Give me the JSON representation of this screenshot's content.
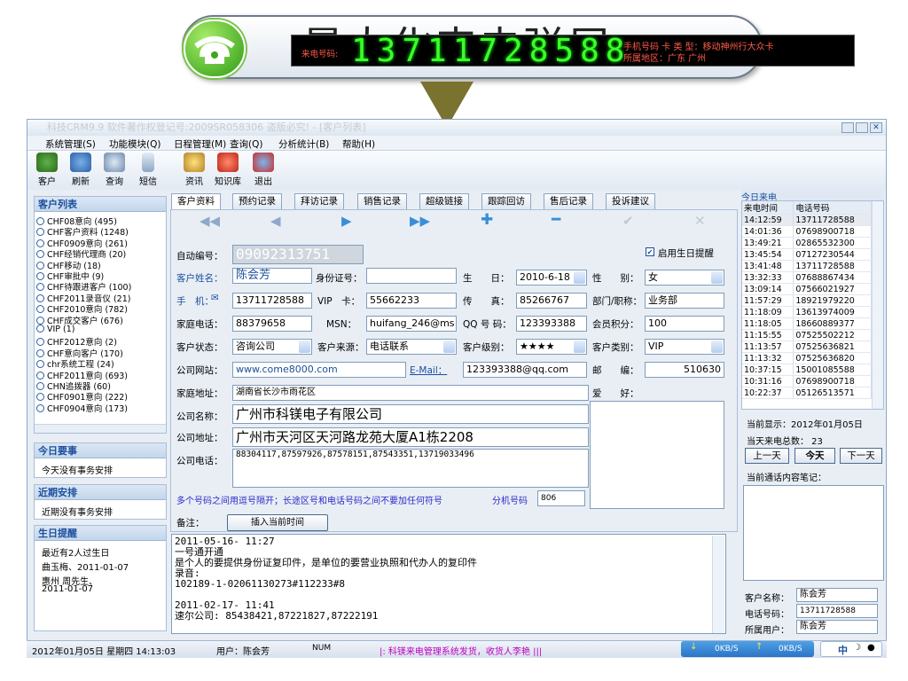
{
  "slide": {
    "title": "最大化来电弹屏"
  },
  "app": {
    "title": "科技CRM9.9 软件著作权登记号:2009SR058306 盗版必究! - [客户列表]",
    "menu": [
      "系统管理(S)",
      "功能模块(Q)",
      "日程管理(M)",
      "查询(Q)",
      "分析统计(B)",
      "帮助(H)"
    ],
    "toolbar": [
      "客户",
      "刷新",
      "查询",
      "短信",
      "资讯",
      "知识库",
      "退出"
    ],
    "led": {
      "caption": "来电号码:",
      "number": "13711728588",
      "line1": "手机号码      卡 类 型：移动神州行大众卡",
      "line2": "所属地区：广东 广州"
    }
  },
  "left": {
    "customer_list_header": "客户列表",
    "customer_items": [
      "CHF08意向 (495)",
      "CHF客户资料 (1248)",
      "CHF0909意向 (261)",
      "CHF经销代理商 (20)",
      "CHF移动 (18)",
      "CHF审批中 (9)",
      "CHF待跟进客户 (100)",
      "CHF2011录音仪 (21)",
      "CHF2010意向 (782)",
      "CHF成交客户 (676)",
      "VIP (1)",
      "CHF2012意向 (2)",
      "CHF意向客户 (170)",
      "chr系统工程 (24)",
      "CHF2011意向 (693)",
      "CHN追拨器 (60)",
      "CHF0901意向 (222)",
      "CHF0904意向 (173)"
    ],
    "today_header": "今日要事",
    "today_text": "今天没有事务安排",
    "recent_header": "近期安排",
    "recent_text": "近期没有事务安排",
    "birthday_header": "生日提醒",
    "birthday_lines": [
      "最近有2人过生日",
      "曲玉梅、2011-01-07",
      "惠州 周先生、",
      "2011-01-07"
    ]
  },
  "tabs": [
    "客户资料",
    "预约记录",
    "拜访记录",
    "销售记录",
    "超级链接",
    "跟踪回访",
    "售后记录",
    "投诉建议"
  ],
  "form": {
    "auto_no_label": "自动编号：",
    "auto_no": "09092313751",
    "birthday_check_label": "启用生日提醒",
    "name_label": "客户姓名：",
    "name": "陈会芳",
    "id_label": "身份证号：",
    "id": "",
    "birth_label": "生　　日：",
    "birth": "2010-6-18",
    "gender_label": "性　　别：",
    "gender": "女",
    "mobile_label": "手　机：",
    "mobile": "13711728588",
    "vip_label": "VIP　卡：",
    "vip": "55662233",
    "fax_label": "传　　真：",
    "fax": "85266767",
    "dept_label": "部门/职称：",
    "dept": "业务部",
    "home_tel_label": "家庭电话：",
    "home_tel": "88379658",
    "msn_label": "MSN：",
    "msn": "huifang_246@ms",
    "qq_label": "QQ 号 码：",
    "qq": "123393388",
    "points_label": "会员积分：",
    "points": "100",
    "status_label": "客户状态：",
    "status": "咨询公司",
    "source_label": "客户来源：",
    "source": "电话联系",
    "level_label": "客户级别：",
    "level": "★★★★",
    "type_label": "客户类别：",
    "type": "VIP",
    "web_label": "公司网站：",
    "web": "www.come8000.com",
    "email_label": "E-Mail：",
    "email": "123393388@qq.com",
    "zip_label": "邮　　编：",
    "zip": "510630",
    "home_addr_label": "家庭地址：",
    "home_addr": "湖南省长沙市雨花区",
    "hobby_label": "爱　　好：",
    "company_label": "公司名称：",
    "company": "广州市科镁电子有限公司",
    "company_addr_label": "公司地址：",
    "company_addr": "广州市天河区天河路龙苑大厦A1栋2208",
    "company_tel_label": "公司电话：",
    "company_tel": "88304117,87597926,87578151,87543351,13719033496",
    "hint": "多个号码之间用逗号隔开；长途区号和电话号码之间不要加任何符号",
    "ext_label": "分机号码",
    "ext": "806",
    "remark_label": "备注：",
    "insert_time_btn": "插入当前时间",
    "notes": [
      "2011-05-16- 11:27",
      "一号通开通",
      "是个人的要提供身份证复印件，是单位的要营业执照和代办人的复印件",
      "录音:",
      "102189-1-02061130273#112233#8",
      "",
      "2011-02-17- 11:41",
      "速尔公司: 85438421,87221827,87222191"
    ]
  },
  "right": {
    "header": "今日来电",
    "col_time": "来电时间",
    "col_phone": "电话号码",
    "calls": [
      [
        "14:12:59",
        "13711728588"
      ],
      [
        "14:01:36",
        "07698900718"
      ],
      [
        "13:49:21",
        "02865532300"
      ],
      [
        "13:45:54",
        "07127230544"
      ],
      [
        "13:41:48",
        "13711728588"
      ],
      [
        "13:32:33",
        "07688867434"
      ],
      [
        "13:09:14",
        "07566021927"
      ],
      [
        "11:57:29",
        "18921979220"
      ],
      [
        "11:18:09",
        "13613974009"
      ],
      [
        "11:18:05",
        "18660889377"
      ],
      [
        "11:15:55",
        "07525502212"
      ],
      [
        "11:13:57",
        "07525636821"
      ],
      [
        "11:13:32",
        "07525636820"
      ],
      [
        "10:37:15",
        "15001085588"
      ],
      [
        "10:31:16",
        "07698900718"
      ],
      [
        "10:22:37",
        "05126513571"
      ]
    ],
    "current_date": "当前显示：2012年01月05日",
    "call_count": "当天来电总数： 23",
    "btn_prev": "上一天",
    "btn_today": "今天",
    "btn_next": "下一天",
    "note_label": "当前通话内容笔记：",
    "cust_name_label": "客户名称：",
    "cust_name": "陈会芳",
    "phone_label": "电话号码：",
    "phone": "13711728588",
    "owner_label": "所属用户：",
    "owner": "陈会芳"
  },
  "status": {
    "datetime": "2012年01月05日 星期四 14:13:03",
    "user": "用户：陈会芳",
    "num": "NUM",
    "ticker": "|: 科镁来电管理系统发货，收货人李艳 |||",
    "down": "0KB/S",
    "up": "0KB/S",
    "ime": "中"
  },
  "colors": {
    "accent": "#1b4f9c",
    "led_green": "#3cff2a",
    "led_red": "#ff5a4a"
  }
}
